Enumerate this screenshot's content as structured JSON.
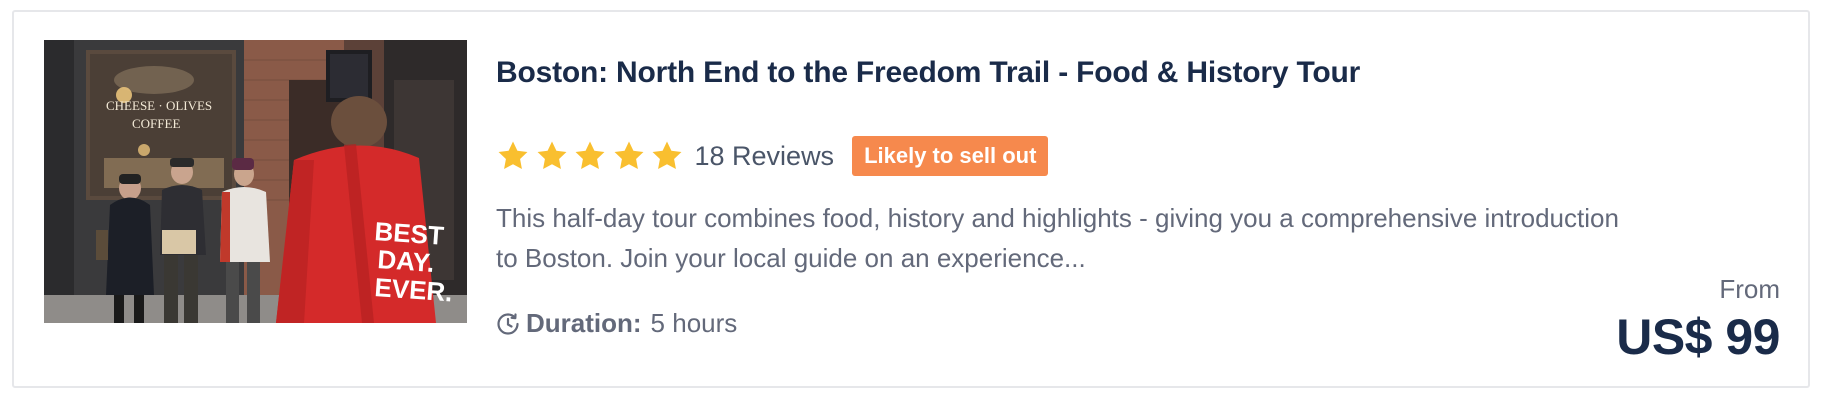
{
  "tour": {
    "title": "Boston: North End to the Freedom Trail - Food & History Tour",
    "image_alt": "Tour group with guide in red jacket outside a North End shop",
    "rating": {
      "stars": 5,
      "max_stars": 5,
      "star_color": "#f9bf2f",
      "reviews_label": "18 Reviews"
    },
    "badge": {
      "label": "Likely to sell out",
      "color": "#f6894d"
    },
    "description": "This half-day tour combines food, history and highlights - giving you a comprehensive introduction to Boston. Join your local guide on an experience...",
    "duration": {
      "icon": "clock-icon",
      "label": "Duration:",
      "value": "5 hours"
    },
    "price": {
      "from_label": "From",
      "amount": "US$ 99"
    }
  },
  "photo_sign_text": {
    "window": "CHEESE · OLIVES",
    "window2": "COFFEE",
    "jacket": "BEST",
    "jacket2": "DAY.",
    "jacket3": "EVER."
  }
}
